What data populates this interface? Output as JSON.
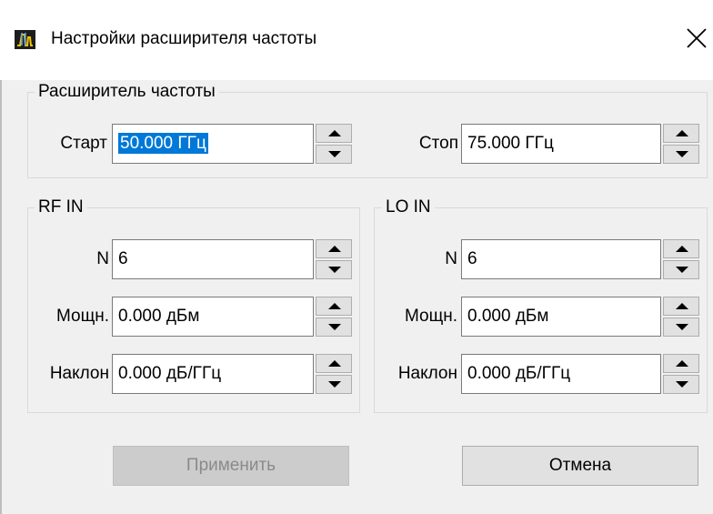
{
  "window": {
    "title": "Настройки расширителя частоты"
  },
  "extender": {
    "legend": "Расширитель частоты",
    "start_label": "Старт",
    "start_value": "50.000 ГГц",
    "stop_label": "Стоп",
    "stop_value": "75.000 ГГц"
  },
  "rf_in": {
    "legend": "RF IN",
    "n_label": "N",
    "n_value": "6",
    "power_label": "Мощн.",
    "power_value": "0.000 дБм",
    "slope_label": "Наклон",
    "slope_value": "0.000 дБ/ГГц"
  },
  "lo_in": {
    "legend": "LO IN",
    "n_label": "N",
    "n_value": "6",
    "power_label": "Мощн.",
    "power_value": "0.000 дБм",
    "slope_label": "Наклон",
    "slope_value": "0.000 дБ/ГГц"
  },
  "buttons": {
    "apply": "Применить",
    "cancel": "Отмена"
  },
  "colors": {
    "selection": "#0078d7",
    "background": "#f0f0f0",
    "titlebar": "#ffffff"
  },
  "icons": {
    "app": "frequency-extender-icon",
    "close": "close-icon"
  }
}
